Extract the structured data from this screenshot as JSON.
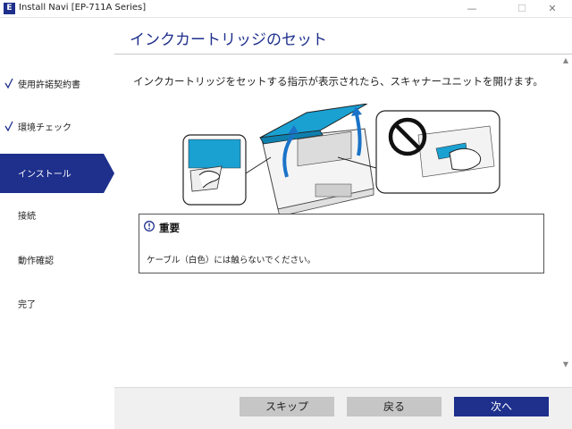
{
  "window": {
    "icon_glyph": "E",
    "title": "Install Navi [EP-711A Series]",
    "controls": {
      "minimize": "—",
      "maximize": "☐",
      "close": "✕"
    }
  },
  "sidebar": {
    "steps": [
      {
        "label": "使用許諾契約書",
        "state": "done"
      },
      {
        "label": "環境チェック",
        "state": "done"
      },
      {
        "label": "インストール",
        "state": "active"
      },
      {
        "label": "接続",
        "state": "pending"
      },
      {
        "label": "動作確認",
        "state": "pending"
      },
      {
        "label": "完了",
        "state": "pending"
      }
    ]
  },
  "header": {
    "title": "インクカートリッジのセット"
  },
  "main": {
    "instruction": "インクカートリッジをセットする指示が表示されたら、スキャナーユニットを開けます。",
    "notice": {
      "title": "重要",
      "text": "ケーブル（白色）には触らないでください。"
    }
  },
  "footer": {
    "skip_label": "スキップ",
    "back_label": "戻る",
    "next_label": "次へ"
  },
  "colors": {
    "accent": "#1e2f8c",
    "scanner_blue": "#1aa1d2",
    "button_gray": "#c6c6c6"
  }
}
